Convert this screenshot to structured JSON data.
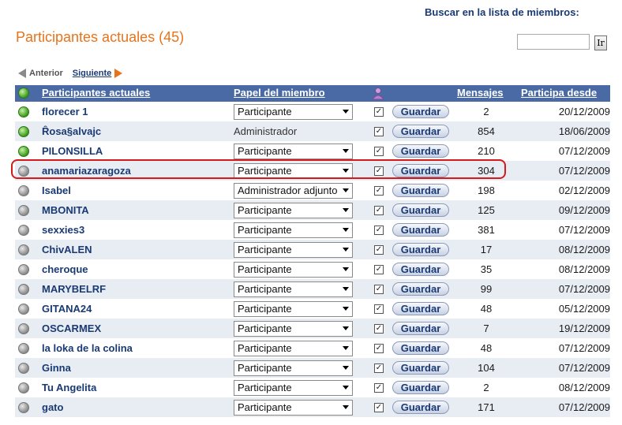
{
  "search": {
    "label": "Buscar en la lista de miembros:",
    "value": "",
    "go_label": "Ir"
  },
  "title": "Participantes actuales (45)",
  "pager": {
    "prev": "Anterior",
    "next": "Siguiente"
  },
  "columns": {
    "name": "Participantes actuales",
    "role": "Papel del miembro",
    "messages": "Mensajes",
    "since": "Participa desde"
  },
  "save_label": "Guardar",
  "rows": [
    {
      "online": true,
      "name": "florecer 1",
      "role": "Participante",
      "editable": true,
      "messages": "2",
      "since": "20/12/2009"
    },
    {
      "online": true,
      "name": "Ȓosa§alvajc",
      "role": "Administrador",
      "editable": false,
      "messages": "854",
      "since": "18/06/2009"
    },
    {
      "online": true,
      "name": "PILONSILLA",
      "role": "Participante",
      "editable": true,
      "messages": "210",
      "since": "07/12/2009"
    },
    {
      "online": false,
      "name": "anamariazaragoza",
      "role": "Participante",
      "editable": true,
      "messages": "304",
      "since": "07/12/2009"
    },
    {
      "online": false,
      "name": "Isabel",
      "role": "Administrador adjunto",
      "editable": true,
      "messages": "198",
      "since": "02/12/2009"
    },
    {
      "online": false,
      "name": "MBONITA",
      "role": "Participante",
      "editable": true,
      "messages": "125",
      "since": "09/12/2009"
    },
    {
      "online": false,
      "name": "sexxies3",
      "role": "Participante",
      "editable": true,
      "messages": "381",
      "since": "07/12/2009"
    },
    {
      "online": false,
      "name": "ChivALEN",
      "role": "Participante",
      "editable": true,
      "messages": "17",
      "since": "08/12/2009"
    },
    {
      "online": false,
      "name": "cheroque",
      "role": "Participante",
      "editable": true,
      "messages": "35",
      "since": "08/12/2009"
    },
    {
      "online": false,
      "name": "MARYBELRF",
      "role": "Participante",
      "editable": true,
      "messages": "99",
      "since": "07/12/2009"
    },
    {
      "online": false,
      "name": "GITANA24",
      "role": "Participante",
      "editable": true,
      "messages": "48",
      "since": "05/12/2009"
    },
    {
      "online": false,
      "name": "OSCARMEX",
      "role": "Participante",
      "editable": true,
      "messages": "7",
      "since": "19/12/2009"
    },
    {
      "online": false,
      "name": "la loka de la colina",
      "role": "Participante",
      "editable": true,
      "messages": "48",
      "since": "07/12/2009"
    },
    {
      "online": false,
      "name": "Ginna",
      "role": "Participante",
      "editable": true,
      "messages": "104",
      "since": "07/12/2009"
    },
    {
      "online": false,
      "name": "Tu Angelita",
      "role": "Participante",
      "editable": true,
      "messages": "2",
      "since": "08/12/2009"
    },
    {
      "online": false,
      "name": "gato",
      "role": "Participante",
      "editable": true,
      "messages": "171",
      "since": "07/12/2009"
    }
  ]
}
